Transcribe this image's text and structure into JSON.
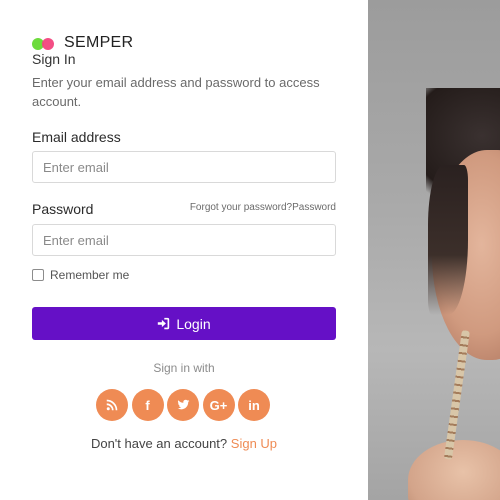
{
  "brand": {
    "name": "SEMPER",
    "colors": {
      "dot_left": "#6ddb3c",
      "dot_right": "#f2457d"
    }
  },
  "signin": {
    "title": "Sign In",
    "description": "Enter your email address and password to access account."
  },
  "form": {
    "email": {
      "label": "Email address",
      "placeholder": "Enter email",
      "value": ""
    },
    "password": {
      "label": "Password",
      "placeholder": "Enter email",
      "value": "",
      "forgot_link": "Forgot your password?Password"
    },
    "remember": {
      "label": "Remember me",
      "checked": false
    },
    "login_button": {
      "label": "Login",
      "icon": "sign-in-icon",
      "color": "#6510c6"
    }
  },
  "social": {
    "heading": "Sign in with",
    "accent_color": "#ef8b54",
    "buttons": [
      {
        "name": "rss",
        "icon": "rss-icon",
        "glyph": ""
      },
      {
        "name": "facebook",
        "icon": "facebook-icon",
        "glyph": "f"
      },
      {
        "name": "twitter",
        "icon": "twitter-icon",
        "glyph": ""
      },
      {
        "name": "google-plus",
        "icon": "google-plus-icon",
        "glyph": "G+"
      },
      {
        "name": "linkedin",
        "icon": "linkedin-icon",
        "glyph": "in"
      }
    ]
  },
  "footer": {
    "prompt": "Don't have an account?",
    "signup_link": "Sign Up"
  }
}
